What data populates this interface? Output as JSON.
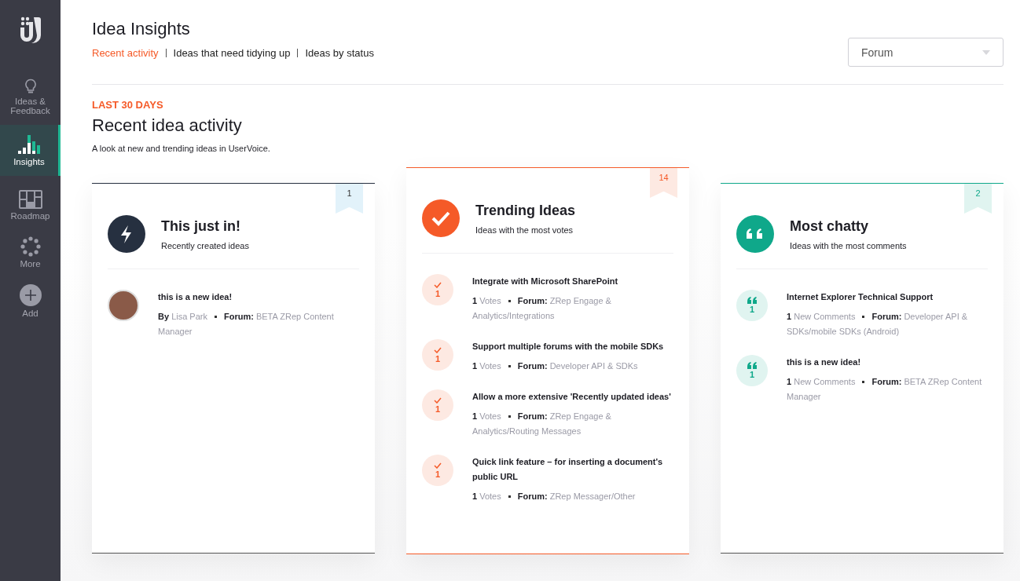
{
  "sidebar": {
    "items": [
      {
        "label": "Ideas & Feedback",
        "selected": false
      },
      {
        "label": "Insights",
        "selected": true
      },
      {
        "label": "Roadmap",
        "selected": false
      },
      {
        "label": "More",
        "selected": false
      },
      {
        "label": "Add",
        "selected": false
      }
    ]
  },
  "header": {
    "title": "Idea Insights",
    "tabs": [
      {
        "label": "Recent activity",
        "selected": true
      },
      {
        "label": "Ideas that need tidying up",
        "selected": false
      },
      {
        "label": "Ideas by status",
        "selected": false
      }
    ],
    "dropdown": {
      "value": "Forum"
    }
  },
  "section": {
    "eyebrow": "LAST 30 DAYS",
    "title": "Recent idea activity",
    "description": "A look at new and trending ideas in UserVoice."
  },
  "cards": [
    {
      "kind": "new",
      "color": "#263040",
      "raised": false,
      "badge": "1",
      "title": "This just in!",
      "subtitle": "Recently created ideas",
      "items": [
        {
          "title": "this is a new idea!",
          "by_label": "By",
          "author": "Lisa Park",
          "forum_label": "Forum:",
          "forum": "BETA ZRep Content Manager"
        }
      ]
    },
    {
      "kind": "votes",
      "color": "#f55a28",
      "raised": true,
      "badge": "14",
      "title": "Trending Ideas",
      "subtitle": "Ideas with the most votes",
      "items": [
        {
          "title": "Integrate with Microsoft SharePoint",
          "badge_count": "1",
          "count": "1",
          "count_label": "Votes",
          "forum_label": "Forum:",
          "forum": "ZRep Engage & Analytics/Integrations"
        },
        {
          "title": "Support multiple forums with the mobile SDKs",
          "badge_count": "1",
          "count": "1",
          "count_label": "Votes",
          "forum_label": "Forum:",
          "forum": "Developer API & SDKs"
        },
        {
          "title": "Allow a more extensive 'Recently updated ideas'",
          "badge_count": "1",
          "count": "1",
          "count_label": "Votes",
          "forum_label": "Forum:",
          "forum": "ZRep Engage & Analytics/Routing Messages"
        },
        {
          "title": "Quick link feature – for inserting a document's public URL",
          "badge_count": "1",
          "count": "1",
          "count_label": "Votes",
          "forum_label": "Forum:",
          "forum": "ZRep Messager/Other"
        }
      ]
    },
    {
      "kind": "comments",
      "color": "#0fa88a",
      "raised": false,
      "badge": "2",
      "title": "Most chatty",
      "subtitle": "Ideas with the most comments",
      "items": [
        {
          "title": "Internet Explorer Technical Support",
          "badge_count": "1",
          "count": "1",
          "count_label": "New Comments",
          "forum_label": "Forum:",
          "forum": "Developer API & SDKs/mobile SDKs (Android)"
        },
        {
          "title": "this is a new idea!",
          "badge_count": "1",
          "count": "1",
          "count_label": "New Comments",
          "forum_label": "Forum:",
          "forum": "BETA ZRep Content Manager"
        }
      ]
    }
  ]
}
